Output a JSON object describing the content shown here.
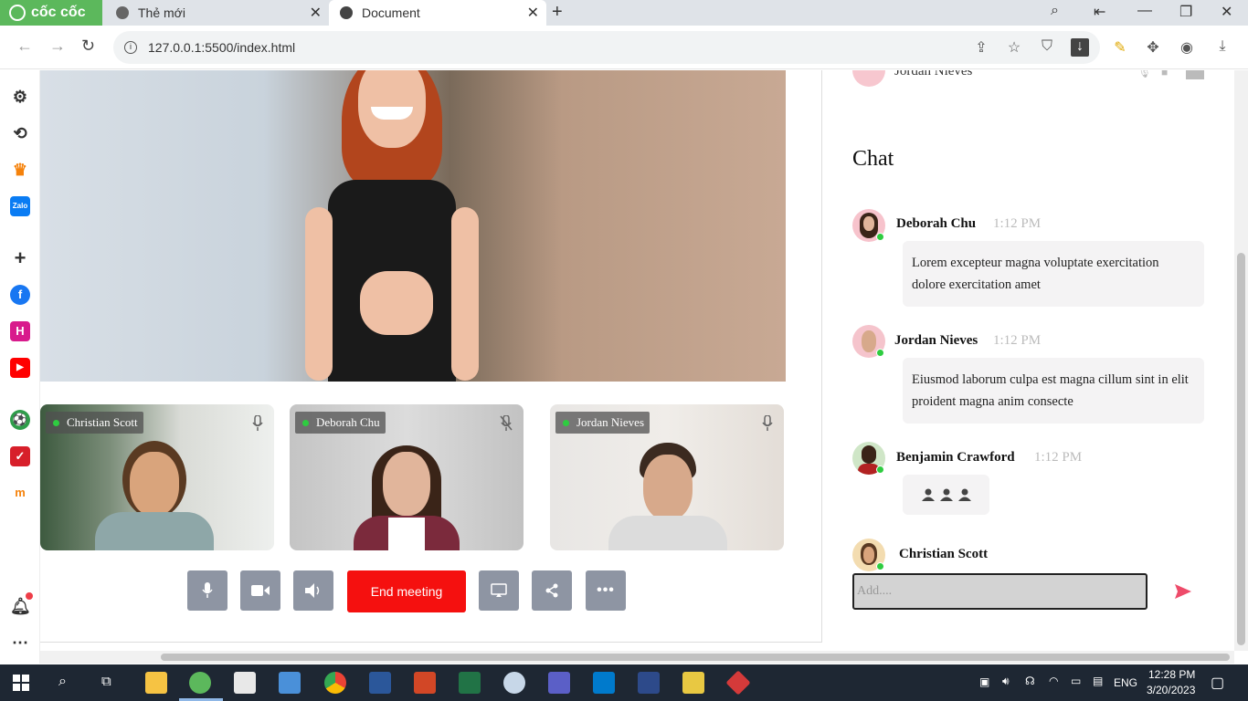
{
  "browser": {
    "brand": "cốc cốc",
    "tabs": [
      {
        "label": "Thẻ mới"
      },
      {
        "label": "Document"
      }
    ],
    "url": "127.0.0.1:5500/index.html"
  },
  "participants": [
    {
      "name": "Christian Scott",
      "mic": "on"
    },
    {
      "name": "Deborah Chu",
      "mic": "muted"
    },
    {
      "name": "Jordan Nieves",
      "mic": "on"
    }
  ],
  "controls": {
    "end_meeting": "End meeting"
  },
  "panel": {
    "top_participant": "Jordan Nieves",
    "chat_title": "Chat",
    "messages": [
      {
        "name": "Deborah Chu",
        "time": "1:12 PM",
        "text": "Lorem excepteur magna voluptate exercitation dolore exercitation amet"
      },
      {
        "name": "Jordan Nieves",
        "time": "1:12 PM",
        "text": "Eiusmod laborum culpa est magna cillum sint in elit proident magna anim consecte"
      },
      {
        "name": "Benjamin Crawford",
        "time": "1:12 PM",
        "text": "typing"
      }
    ],
    "current_user": "Christian Scott",
    "input_placeholder": "Add...."
  },
  "taskbar": {
    "language": "ENG",
    "time": "12:28 PM",
    "date": "3/20/2023"
  },
  "colors": {
    "end_button": "#f5100f",
    "control_button": "#8e95a3",
    "online": "#2ecc40",
    "send": "#ee4b6a",
    "brand": "#5cb85c"
  }
}
